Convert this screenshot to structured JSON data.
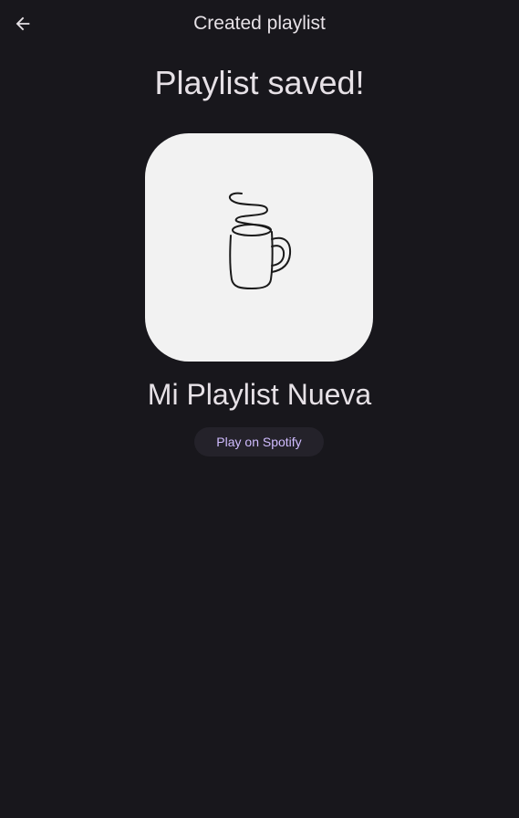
{
  "top_bar": {
    "back_icon": "arrow-left-icon",
    "title": "Created playlist"
  },
  "main": {
    "headline": "Playlist saved!",
    "cover_icon": "coffee-mug-line-art-icon",
    "playlist_name": "Mi Playlist Nueva",
    "play_button_label": "Play on Spotify"
  },
  "colors": {
    "background": "#18171c",
    "text": "#e6e1e6",
    "accent": "#d0bcff",
    "button_surface": "#24222a",
    "cover_background": "#f2f2f2"
  }
}
